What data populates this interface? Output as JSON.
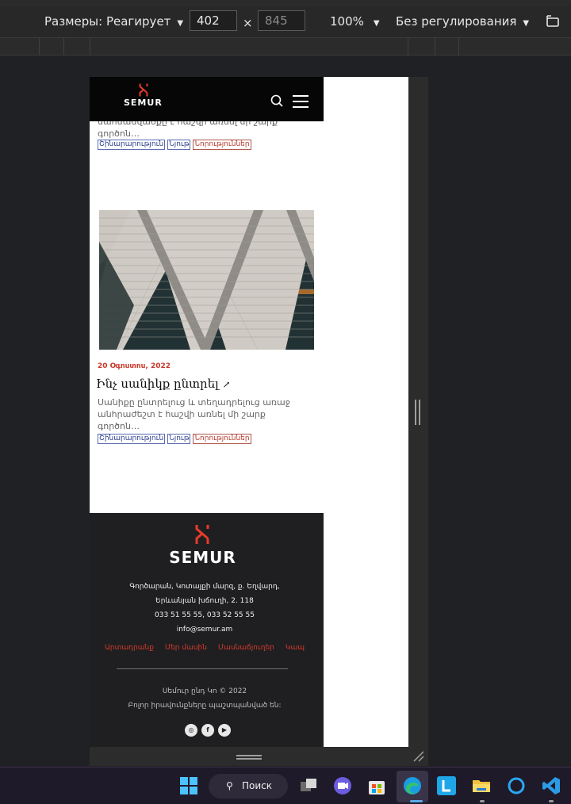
{
  "devtools": {
    "dimensions_label": "Размеры: Реагирует",
    "width_value": "402",
    "times": "×",
    "height_placeholder": "845",
    "zoom_label": "100%",
    "throttle_label": "Без регулирования"
  },
  "site": {
    "logo_text": "SEMUR",
    "brand_color": "#e63b2b"
  },
  "prev_post": {
    "excerpt_lines": [
      "սահմանվածքը է հաշվի առնել մի շարք",
      "գործոն…"
    ],
    "tags": [
      "Շինարարություն",
      "Նյութ",
      "Նորություններ"
    ]
  },
  "post": {
    "date": "20 Օգոստոս, 2022",
    "title": "Ինչ սանիկք ընտրել",
    "excerpt_lines": [
      "Սանիքը ընտրելուց և տեղադրելուց առաջ",
      "անհրաժեշտ է հաշվի առնել մի շարք",
      "գործոն…"
    ],
    "tags": [
      "Շինարարություն",
      "Նյութ",
      "Նորություններ"
    ]
  },
  "footer": {
    "logo_text": "SEMUR",
    "address_line1": "Գործարան, Կոտայքի մարզ, ք. Եղվարդ,",
    "address_line2": "Երևանյան խճուղի, 2. 118",
    "phones": "033 51 55 55, 033 52 55 55",
    "email": "info@semur.am",
    "nav": [
      "Արտադրանք",
      "Մեր մասին",
      "Մասնաճյուղեր",
      "Կապ"
    ],
    "copyright": "Սեմուր ընդ Կո © 2022",
    "rights": "Բոլոր իրավունքները պաշտպանված են:",
    "social": [
      "instagram-icon",
      "facebook-icon",
      "youtube-icon"
    ]
  },
  "taskbar": {
    "search_label": "Поиск"
  }
}
